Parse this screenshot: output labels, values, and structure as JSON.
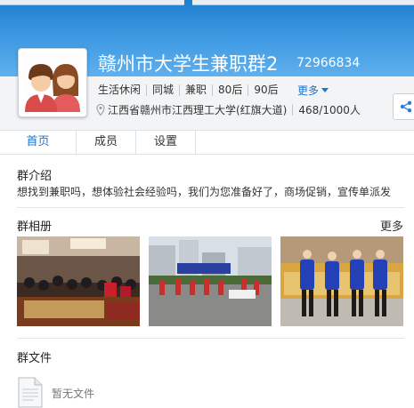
{
  "header": {
    "name": "赣州市大学生兼职群2",
    "id": "72966834"
  },
  "tags": [
    "生活休闲",
    "同城",
    "兼职",
    "80后",
    "90后"
  ],
  "more_label": "更多",
  "location": "江西省赣州市江西理工大学(红旗大道)",
  "members": "468/1000人",
  "tabs": [
    {
      "label": "首页",
      "active": true
    },
    {
      "label": "成员",
      "active": false
    },
    {
      "label": "设置",
      "active": false
    }
  ],
  "intro": {
    "title": "群介绍",
    "text": "想找到兼职吗，想体验社会经验吗，我们为您准备好了，商场促销，宣传单派发"
  },
  "album": {
    "title": "群相册",
    "more": "更多"
  },
  "files": {
    "title": "群文件",
    "empty": "暂无文件"
  },
  "colors": {
    "header_top": "#1e7fd0",
    "header_bottom": "#5fb0ee",
    "link": "#1f73c9"
  }
}
